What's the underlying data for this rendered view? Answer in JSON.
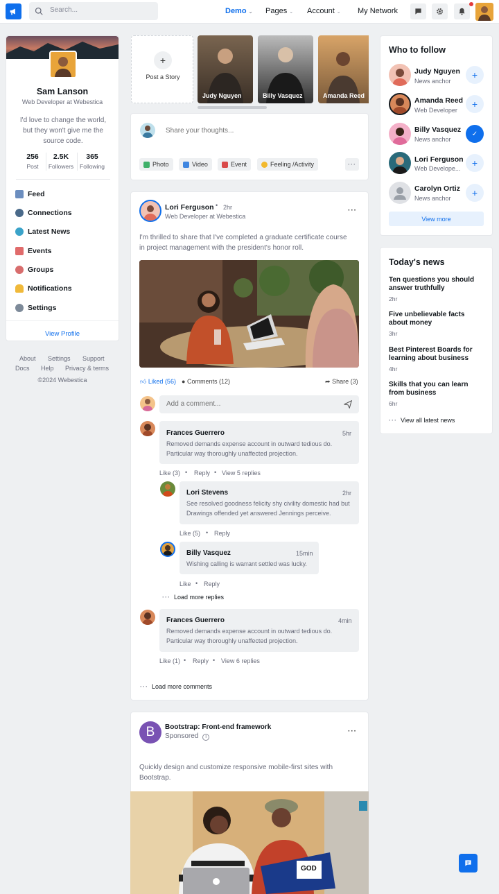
{
  "header": {
    "search_placeholder": "Search...",
    "nav": [
      {
        "label": "Demo",
        "active": true
      },
      {
        "label": "Pages"
      },
      {
        "label": "Account"
      },
      {
        "label": "My Network"
      }
    ],
    "brand_color": "#0f6fec"
  },
  "profile": {
    "name": "Sam Lanson",
    "title": "Web Developer at Webestica",
    "bio": "I'd love to change the world, but they won't give me the source code.",
    "stats": [
      {
        "value": "256",
        "label": "Post"
      },
      {
        "value": "2.5K",
        "label": "Followers"
      },
      {
        "value": "365",
        "label": "Following"
      }
    ],
    "menu": [
      {
        "label": "Feed",
        "icon": "home-icon"
      },
      {
        "label": "Connections",
        "icon": "person-icon"
      },
      {
        "label": "Latest News",
        "icon": "globe-icon"
      },
      {
        "label": "Events",
        "icon": "calendar-icon"
      },
      {
        "label": "Groups",
        "icon": "chat-icon"
      },
      {
        "label": "Notifications",
        "icon": "bell-icon"
      },
      {
        "label": "Settings",
        "icon": "gear-icon"
      }
    ],
    "view_profile": "View Profile"
  },
  "footer": {
    "links": [
      "About",
      "Settings",
      "Support",
      "Docs",
      "Help",
      "Privacy & terms"
    ],
    "copyright": "©2024 Webestica"
  },
  "stories": {
    "post_label": "Post a Story",
    "items": [
      "Judy Nguyen",
      "Billy Vasquez",
      "Amanda Reed"
    ]
  },
  "composer": {
    "placeholder": "Share your thoughts...",
    "actions": [
      "Photo",
      "Video",
      "Event",
      "Feeling /Activity"
    ]
  },
  "post": {
    "author": "Lori Ferguson",
    "time": "2hr",
    "role": "Web Developer at Webestica",
    "text": "I'm thrilled to share that I've completed a graduate certificate course in project management with the president's honor roll.",
    "liked": "Liked (56)",
    "comments": "Comments (12)",
    "share": "Share (3)",
    "comment_placeholder": "Add a comment...",
    "comment_list": [
      {
        "name": "Frances Guerrero",
        "time": "5hr",
        "text": "Removed demands expense account in outward tedious do. Particular way thoroughly unaffected projection.",
        "like": "Like (3)",
        "reply": "Reply",
        "more": "View 5 replies"
      },
      {
        "name": "Lori Stevens",
        "time": "2hr",
        "text": "See resolved goodness felicity shy civility domestic had but Drawings offended yet answered Jennings perceive.",
        "like": "Like (5)",
        "reply": "Reply"
      },
      {
        "name": "Billy Vasquez",
        "time": "15min",
        "text": "Wishing calling is warrant settled was lucky.",
        "like": "Like",
        "reply": "Reply"
      },
      {
        "name": "Frances Guerrero",
        "time": "4min",
        "text": "Removed demands expense account in outward tedious do. Particular way thoroughly unaffected projection.",
        "like": "Like (1)",
        "reply": "Reply",
        "more": "View 6 replies"
      }
    ],
    "load_more_replies": "Load more replies",
    "load_more_comments": "Load more comments"
  },
  "sponsored": {
    "title": "Bootstrap: Front-end framework",
    "label": "Sponsored",
    "text": "Quickly design and customize responsive mobile-first sites with Bootstrap.",
    "logo_letter": "B"
  },
  "who_to_follow": {
    "title": "Who to follow",
    "people": [
      {
        "name": "Judy Nguyen",
        "role": "News anchor"
      },
      {
        "name": "Amanda Reed",
        "role": "Web Developer"
      },
      {
        "name": "Billy Vasquez",
        "role": "News anchor"
      },
      {
        "name": "Lori Ferguson",
        "role": "Web Develope..."
      },
      {
        "name": "Carolyn Ortiz",
        "role": "News anchor"
      }
    ],
    "view_more": "View more"
  },
  "news": {
    "title": "Today's news",
    "items": [
      {
        "title": "Ten questions you should answer truthfully",
        "time": "2hr"
      },
      {
        "title": "Five unbelievable facts about money",
        "time": "3hr"
      },
      {
        "title": "Best Pinterest Boards for learning about business",
        "time": "4hr"
      },
      {
        "title": "Skills that you can learn from business",
        "time": "6hr"
      }
    ],
    "view_all": "View all latest news"
  }
}
